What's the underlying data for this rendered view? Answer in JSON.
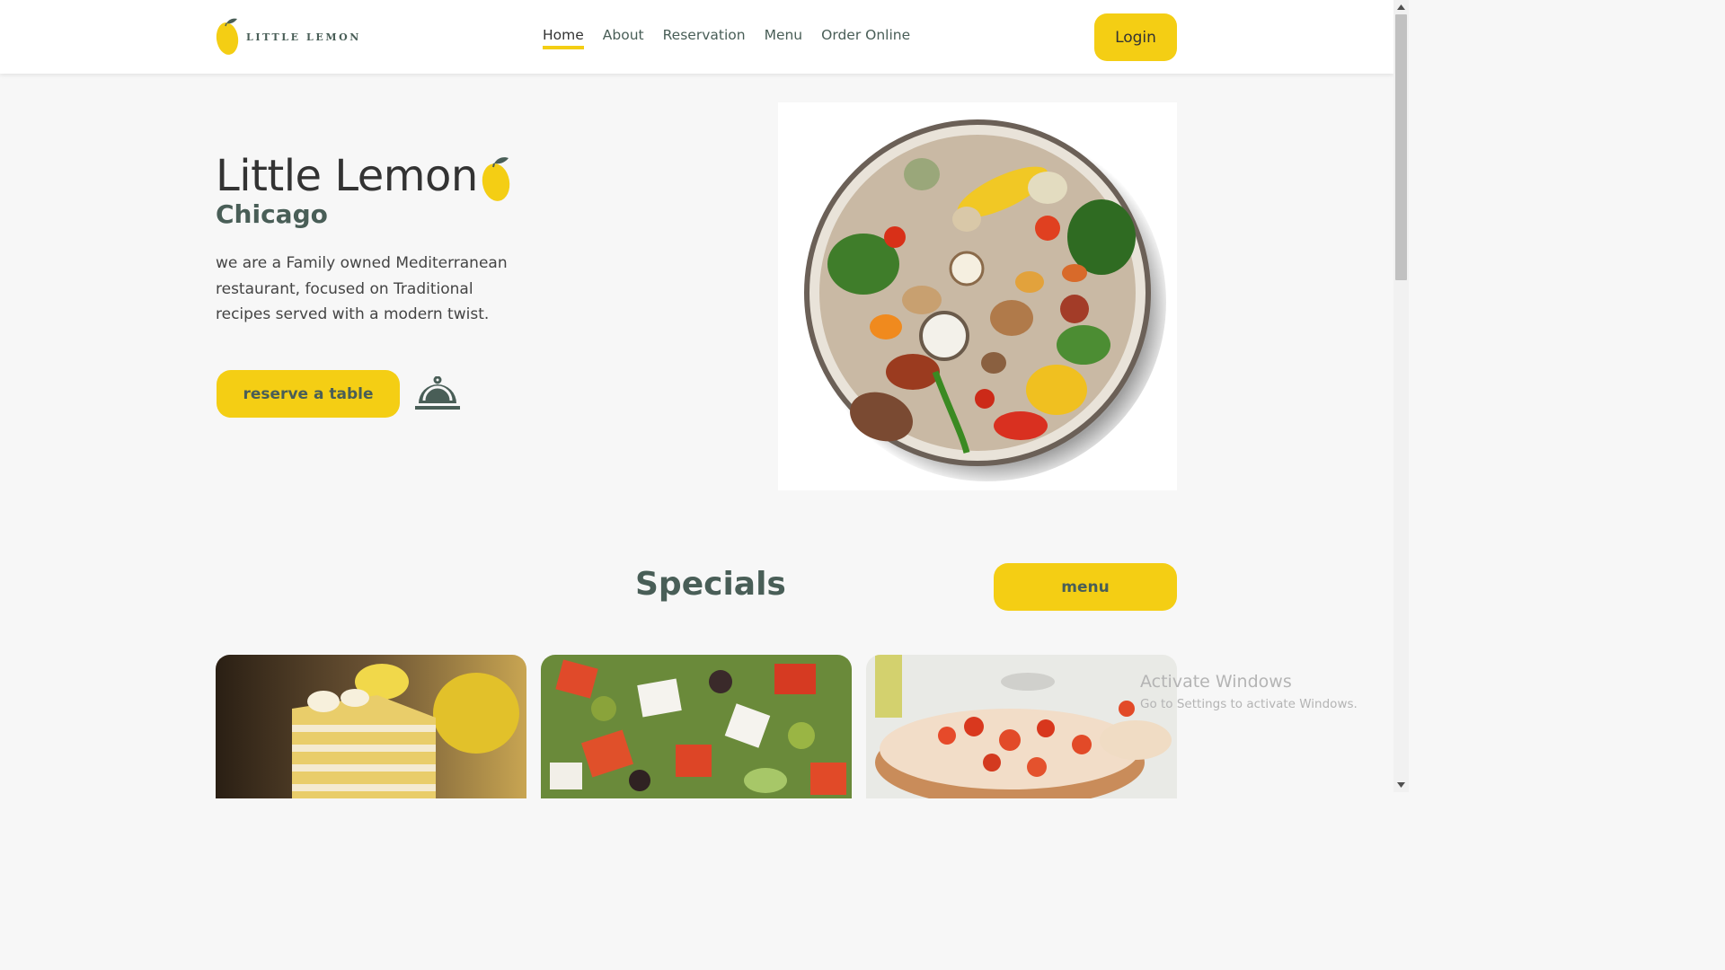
{
  "brand": {
    "name": "LITTLE LEMON",
    "accent": "#f4ce14",
    "green": "#495e57"
  },
  "nav": {
    "items": [
      {
        "label": "Home",
        "active": true
      },
      {
        "label": "About"
      },
      {
        "label": "Reservation"
      },
      {
        "label": "Menu"
      },
      {
        "label": "Order Online"
      }
    ],
    "login_label": "Login"
  },
  "hero": {
    "title": "Little Lemon",
    "subtitle": "Chicago",
    "description": "we are a Family owned Mediterranean restaurant, focused on Traditional recipes served with a modern twist.",
    "reserve_label": "reserve a table",
    "icons": [
      "lemon-icon",
      "cloche-icon"
    ],
    "image": "vegetable-platter"
  },
  "specials": {
    "title": "Specials",
    "menu_label": "menu",
    "cards": [
      {
        "image": "lemon-cake"
      },
      {
        "image": "greek-salad"
      },
      {
        "image": "bruschetta"
      }
    ]
  },
  "watermark": {
    "title": "Activate Windows",
    "subtitle": "Go to Settings to activate Windows."
  }
}
